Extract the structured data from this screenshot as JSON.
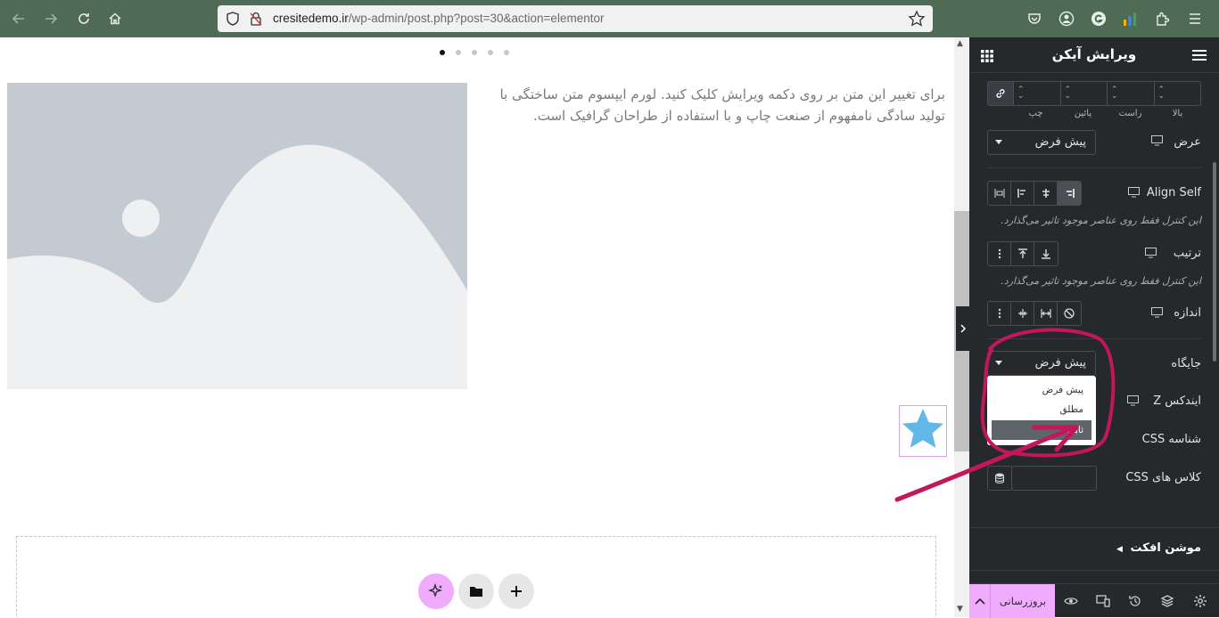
{
  "browser": {
    "url_host": "cresitedemo.ir",
    "url_path": "/wp-admin/post.php?post=30&action=elementor"
  },
  "canvas": {
    "paragraph": "برای تغییر این متن بر روی دکمه ویرایش کلیک کنید. لورم ایپسوم متن ساختگی با تولید سادگی نامفهوم از صنعت چاپ و با استفاده از طراحان گرافیک است.",
    "slider_dots": 5,
    "active_dot": 1
  },
  "panel": {
    "title": "ویرایش آیکن",
    "dimension_labels": [
      "بالا",
      "راست",
      "پائین",
      "چپ"
    ],
    "width_label": "عرض",
    "width_value": "پیش فرض",
    "align_self_label": "Align Self",
    "align_note": "این کنترل فقط روی عناصر موجود تاثیر می‌گذارد.",
    "order_label": "ترتیب",
    "order_note": "این کنترل فقط روی عناصر موجود تاثیر می‌گذارد.",
    "size_label": "اندازه",
    "position_label": "جایگاه",
    "position_value": "پیش فرض",
    "position_options": [
      "پیش فرض",
      "مطلق",
      "ثابت"
    ],
    "position_selected_index": 2,
    "zindex_label": "ایندکس Z",
    "css_id_label": "شناسه CSS",
    "css_classes_label": "کلاس های CSS",
    "motion_section": "موشن افکت",
    "publish_label": "بروزرسانی"
  },
  "colors": {
    "panel_bg": "#26292c",
    "accent": "#f0abfc",
    "annotation": "#c2185b",
    "star": "#61b8e8"
  }
}
